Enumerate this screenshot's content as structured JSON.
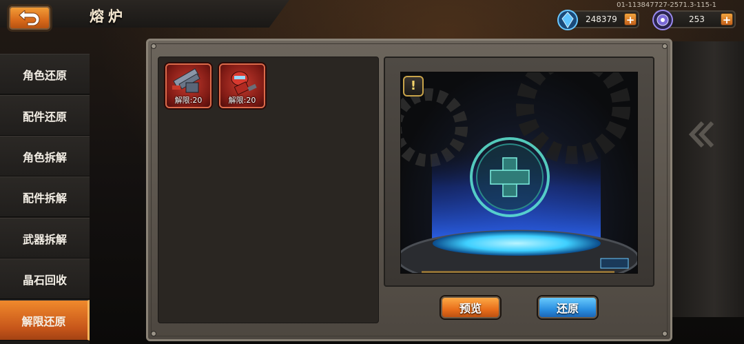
{
  "header": {
    "title": "熔炉",
    "version": "01-113847727-2571.3-115-1"
  },
  "currencies": [
    {
      "name": "crystal",
      "amount": "248379",
      "icon": "blue-crystal-icon",
      "color": "#38a8e8"
    },
    {
      "name": "gem",
      "amount": "253",
      "icon": "purple-gem-icon",
      "color": "#7a6ad8"
    }
  ],
  "sidebar": {
    "items": [
      {
        "label": "角色还原",
        "active": false
      },
      {
        "label": "配件还原",
        "active": false
      },
      {
        "label": "角色拆解",
        "active": false
      },
      {
        "label": "配件拆解",
        "active": false
      },
      {
        "label": "武器拆解",
        "active": false
      },
      {
        "label": "晶石回收",
        "active": false
      },
      {
        "label": "解限还原",
        "active": true
      }
    ]
  },
  "items": [
    {
      "label": "解限:20",
      "icon": "mech-weapon-icon"
    },
    {
      "label": "解限:20",
      "icon": "red-robot-icon"
    }
  ],
  "buttons": {
    "preview": "预览",
    "restore": "还原"
  },
  "colors": {
    "accent_orange": "#e86d1a",
    "accent_blue": "#2a8ee0",
    "panel": "#5c564e"
  }
}
